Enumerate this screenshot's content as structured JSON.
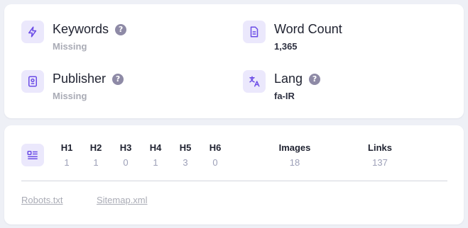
{
  "meta": {
    "keywords": {
      "title": "Keywords",
      "value": "Missing",
      "icon": "bolt-icon"
    },
    "word_count": {
      "title": "Word Count",
      "value": "1,365",
      "icon": "document-icon"
    },
    "publisher": {
      "title": "Publisher",
      "value": "Missing",
      "icon": "id-badge-icon"
    },
    "lang": {
      "title": "Lang",
      "value": "fa-IR",
      "icon": "translate-icon"
    },
    "help_glyph": "?"
  },
  "headings": {
    "icon": "list-icon",
    "columns": [
      {
        "label": "H1",
        "value": "1"
      },
      {
        "label": "H2",
        "value": "1"
      },
      {
        "label": "H3",
        "value": "0"
      },
      {
        "label": "H4",
        "value": "1"
      },
      {
        "label": "H5",
        "value": "3"
      },
      {
        "label": "H6",
        "value": "0"
      }
    ],
    "images": {
      "label": "Images",
      "value": "18"
    },
    "links": {
      "label": "Links",
      "value": "137"
    }
  },
  "footer": {
    "robots": "Robots.txt",
    "sitemap": "Sitemap.xml"
  },
  "colors": {
    "accent": "#6b4ce6",
    "icon_bg": "#ebe8fc",
    "muted": "#a9abb5",
    "value_muted": "#9da0b8"
  }
}
